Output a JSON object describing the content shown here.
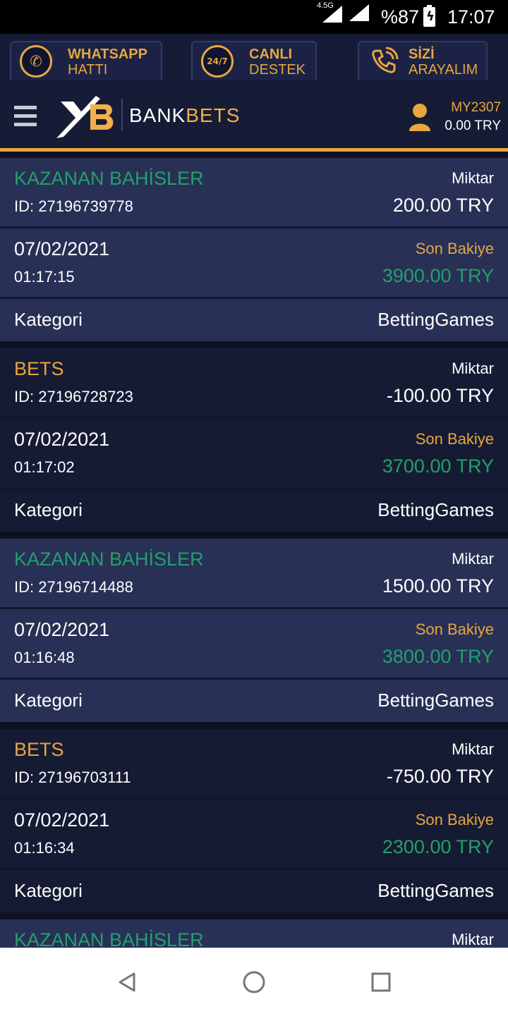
{
  "status_bar": {
    "network": "4.5G",
    "battery": "%87",
    "time": "17:07"
  },
  "support": [
    {
      "line1": "WHATSAPP",
      "line2": "HATTI",
      "icon": "whatsapp-icon"
    },
    {
      "line1": "CANLI",
      "line2": "DESTEK",
      "icon": "support-24-7-icon"
    },
    {
      "line1": "SİZİ",
      "line2": "ARAYALIM",
      "icon": "phone-call-icon"
    }
  ],
  "header": {
    "brand_a": "BANK",
    "brand_b": "BETS",
    "username": "MY2307",
    "balance": "0.00 TRY"
  },
  "labels": {
    "amount": "Miktar",
    "last_balance": "Son Bakiye",
    "category": "Kategori"
  },
  "colors": {
    "accent": "#e7a63e",
    "win": "#22a06b"
  },
  "transactions": [
    {
      "type": "KAZANAN BAHİSLER",
      "id": "ID: 27196739778",
      "amount": "200.00 TRY",
      "date": "07/02/2021",
      "time": "01:17:15",
      "balance": "3900.00 TRY",
      "category": "BettingGames"
    },
    {
      "type": "BETS",
      "id": "ID: 27196728723",
      "amount": "-100.00 TRY",
      "date": "07/02/2021",
      "time": "01:17:02",
      "balance": "3700.00 TRY",
      "category": "BettingGames"
    },
    {
      "type": "KAZANAN BAHİSLER",
      "id": "ID: 27196714488",
      "amount": "1500.00 TRY",
      "date": "07/02/2021",
      "time": "01:16:48",
      "balance": "3800.00 TRY",
      "category": "BettingGames"
    },
    {
      "type": "BETS",
      "id": "ID: 27196703111",
      "amount": "-750.00 TRY",
      "date": "07/02/2021",
      "time": "01:16:34",
      "balance": "2300.00 TRY",
      "category": "BettingGames"
    },
    {
      "type": "KAZANAN BAHİSLER",
      "label": "Miktar"
    }
  ]
}
